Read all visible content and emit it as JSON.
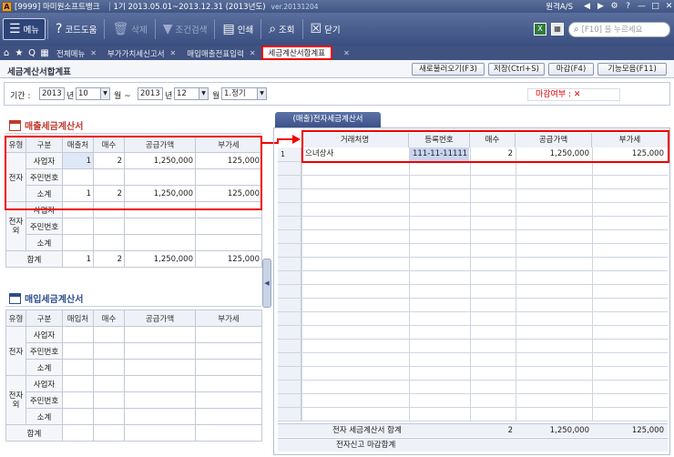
{
  "titlebar": {
    "company": "[9999] 마미원소프트뱅크",
    "period": "1기 2013.05.01~2013.12.31 (2013년도)",
    "version": "ver.20131204",
    "help": "원격A/S"
  },
  "toolbar": {
    "menu": "메뉴",
    "code_help": "코드도움",
    "delete": "삭제",
    "condition_search": "조건검색",
    "print": "인쇄",
    "view": "조회",
    "close": "닫기",
    "search_placeholder": "[F10] 을 누르세요"
  },
  "tabs": [
    {
      "label": "전체메뉴"
    },
    {
      "label": "부가가치세신고서"
    },
    {
      "label": "매입매출전표입력"
    },
    {
      "label": "세금계산서합계표"
    }
  ],
  "page": {
    "title": "세금계산서합계표",
    "buttons": [
      "새로불러오기(F3)",
      "저장(Ctrl+S)",
      "마감(F4)",
      "기능모음(F11)"
    ]
  },
  "filter": {
    "period_label": "기간 :",
    "start_year": "2013",
    "year_suffix": "년",
    "start_month": "10",
    "month_suffix": "월 ~",
    "end_year": "2013",
    "end_month": "12",
    "end_month_suffix": "월",
    "quarter": "1.정기",
    "closing_label": "마감여부 :",
    "closing_value": "✕"
  },
  "sales": {
    "title": "매출세금계산서",
    "headers": [
      "유형",
      "구분",
      "매출처",
      "매수",
      "공급가액",
      "부가세"
    ],
    "rows": [
      {
        "type": "전자",
        "div": "사업자",
        "count": "1",
        "sheets": "2",
        "supply": "1,250,000",
        "vat": "125,000"
      },
      {
        "type": "",
        "div": "주민번호",
        "count": "",
        "sheets": "",
        "supply": "",
        "vat": ""
      },
      {
        "type": "",
        "div": "소계",
        "count": "1",
        "sheets": "2",
        "supply": "1,250,000",
        "vat": "125,000"
      },
      {
        "type": "전자외",
        "div": "사업자",
        "count": "",
        "sheets": "",
        "supply": "",
        "vat": ""
      },
      {
        "type": "",
        "div": "주민번호",
        "count": "",
        "sheets": "",
        "supply": "",
        "vat": ""
      },
      {
        "type": "",
        "div": "소계",
        "count": "",
        "sheets": "",
        "supply": "",
        "vat": ""
      }
    ],
    "total": {
      "label": "합계",
      "count": "1",
      "sheets": "2",
      "supply": "1,250,000",
      "vat": "125,000"
    }
  },
  "purchase": {
    "title": "매입세금계산서",
    "headers": [
      "유형",
      "구분",
      "매입처",
      "매수",
      "공급가액",
      "부가세"
    ],
    "rows": [
      {
        "type": "전자",
        "div": "사업자"
      },
      {
        "type": "",
        "div": "주민번호"
      },
      {
        "type": "",
        "div": "소계"
      },
      {
        "type": "전자외",
        "div": "사업자"
      },
      {
        "type": "",
        "div": "주민번호"
      },
      {
        "type": "",
        "div": "소계"
      }
    ],
    "total": {
      "label": "합계"
    }
  },
  "detail": {
    "tab": "(매출)전자세금계산서",
    "headers": [
      "거래처명",
      "등록번호",
      "매수",
      "공급가액",
      "부가세"
    ],
    "rows": [
      {
        "num": "1",
        "name": "으녀상사",
        "reg": "111-11-11111",
        "sheets": "2",
        "supply": "1,250,000",
        "vat": "125,000"
      }
    ],
    "footer1": {
      "label": "전자 세금계산서 합계",
      "sheets": "2",
      "supply": "1,250,000",
      "vat": "125,000"
    },
    "footer2": {
      "label": "전자신고 마감합계"
    }
  }
}
